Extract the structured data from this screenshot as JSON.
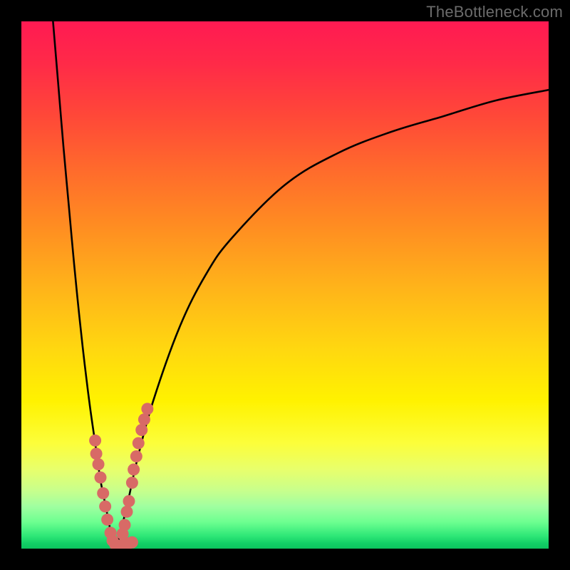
{
  "watermark": "TheBottleneck.com",
  "colors": {
    "frame": "#000000",
    "curve": "#000000",
    "dot": "#d86a66",
    "dot_stroke": "#c85a58"
  },
  "chart_data": {
    "type": "line",
    "title": "",
    "xlabel": "",
    "ylabel": "",
    "xlim": [
      0,
      100
    ],
    "ylim": [
      0,
      100
    ],
    "series": [
      {
        "name": "left-branch",
        "x": [
          6,
          7,
          8,
          9,
          10,
          11,
          12,
          13,
          14,
          15,
          16,
          17,
          18
        ],
        "y": [
          100,
          88,
          76,
          65,
          54,
          44,
          35,
          27,
          20,
          13,
          8,
          3,
          0
        ]
      },
      {
        "name": "right-branch",
        "x": [
          18,
          20,
          22,
          25,
          30,
          35,
          40,
          50,
          60,
          70,
          80,
          90,
          100
        ],
        "y": [
          0,
          8,
          17,
          28,
          42,
          52,
          59,
          69,
          75,
          79,
          82,
          85,
          87
        ]
      }
    ],
    "scatter": [
      {
        "name": "left-cluster",
        "points": [
          [
            14.0,
            20.5
          ],
          [
            14.2,
            18.0
          ],
          [
            14.6,
            16.0
          ],
          [
            15.0,
            13.5
          ],
          [
            15.5,
            10.5
          ],
          [
            15.9,
            8.0
          ],
          [
            16.3,
            5.5
          ],
          [
            16.9,
            3.0
          ],
          [
            17.3,
            1.5
          ],
          [
            17.8,
            0.8
          ]
        ]
      },
      {
        "name": "bottom-cluster",
        "points": [
          [
            18.2,
            0.5
          ],
          [
            18.9,
            0.6
          ],
          [
            19.6,
            0.8
          ],
          [
            20.3,
            1.0
          ],
          [
            21.0,
            1.2
          ]
        ]
      },
      {
        "name": "right-cluster",
        "points": [
          [
            21.0,
            12.5
          ],
          [
            21.3,
            15.0
          ],
          [
            21.8,
            17.5
          ],
          [
            22.2,
            20.0
          ],
          [
            22.8,
            22.5
          ],
          [
            23.3,
            24.5
          ],
          [
            23.9,
            26.5
          ],
          [
            20.0,
            7.0
          ],
          [
            20.4,
            9.0
          ],
          [
            19.6,
            4.5
          ],
          [
            19.2,
            2.8
          ]
        ]
      }
    ]
  }
}
